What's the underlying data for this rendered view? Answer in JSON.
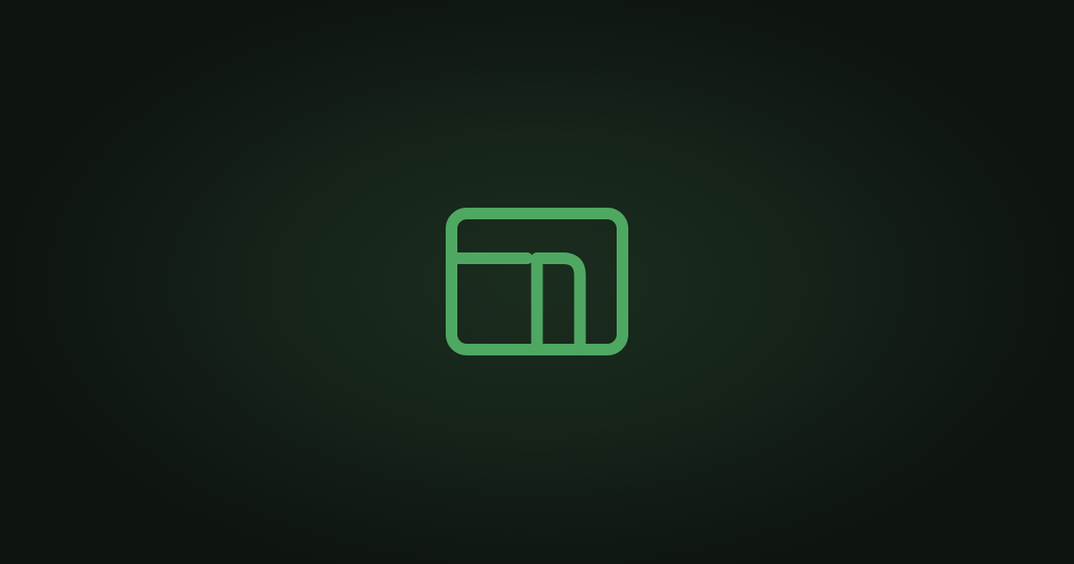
{
  "logo": {
    "icon": "layout-panels-icon",
    "stroke_color": "#4fa862"
  },
  "colors": {
    "background_center": "#1b2d1f",
    "background_edge": "#0e1410"
  }
}
